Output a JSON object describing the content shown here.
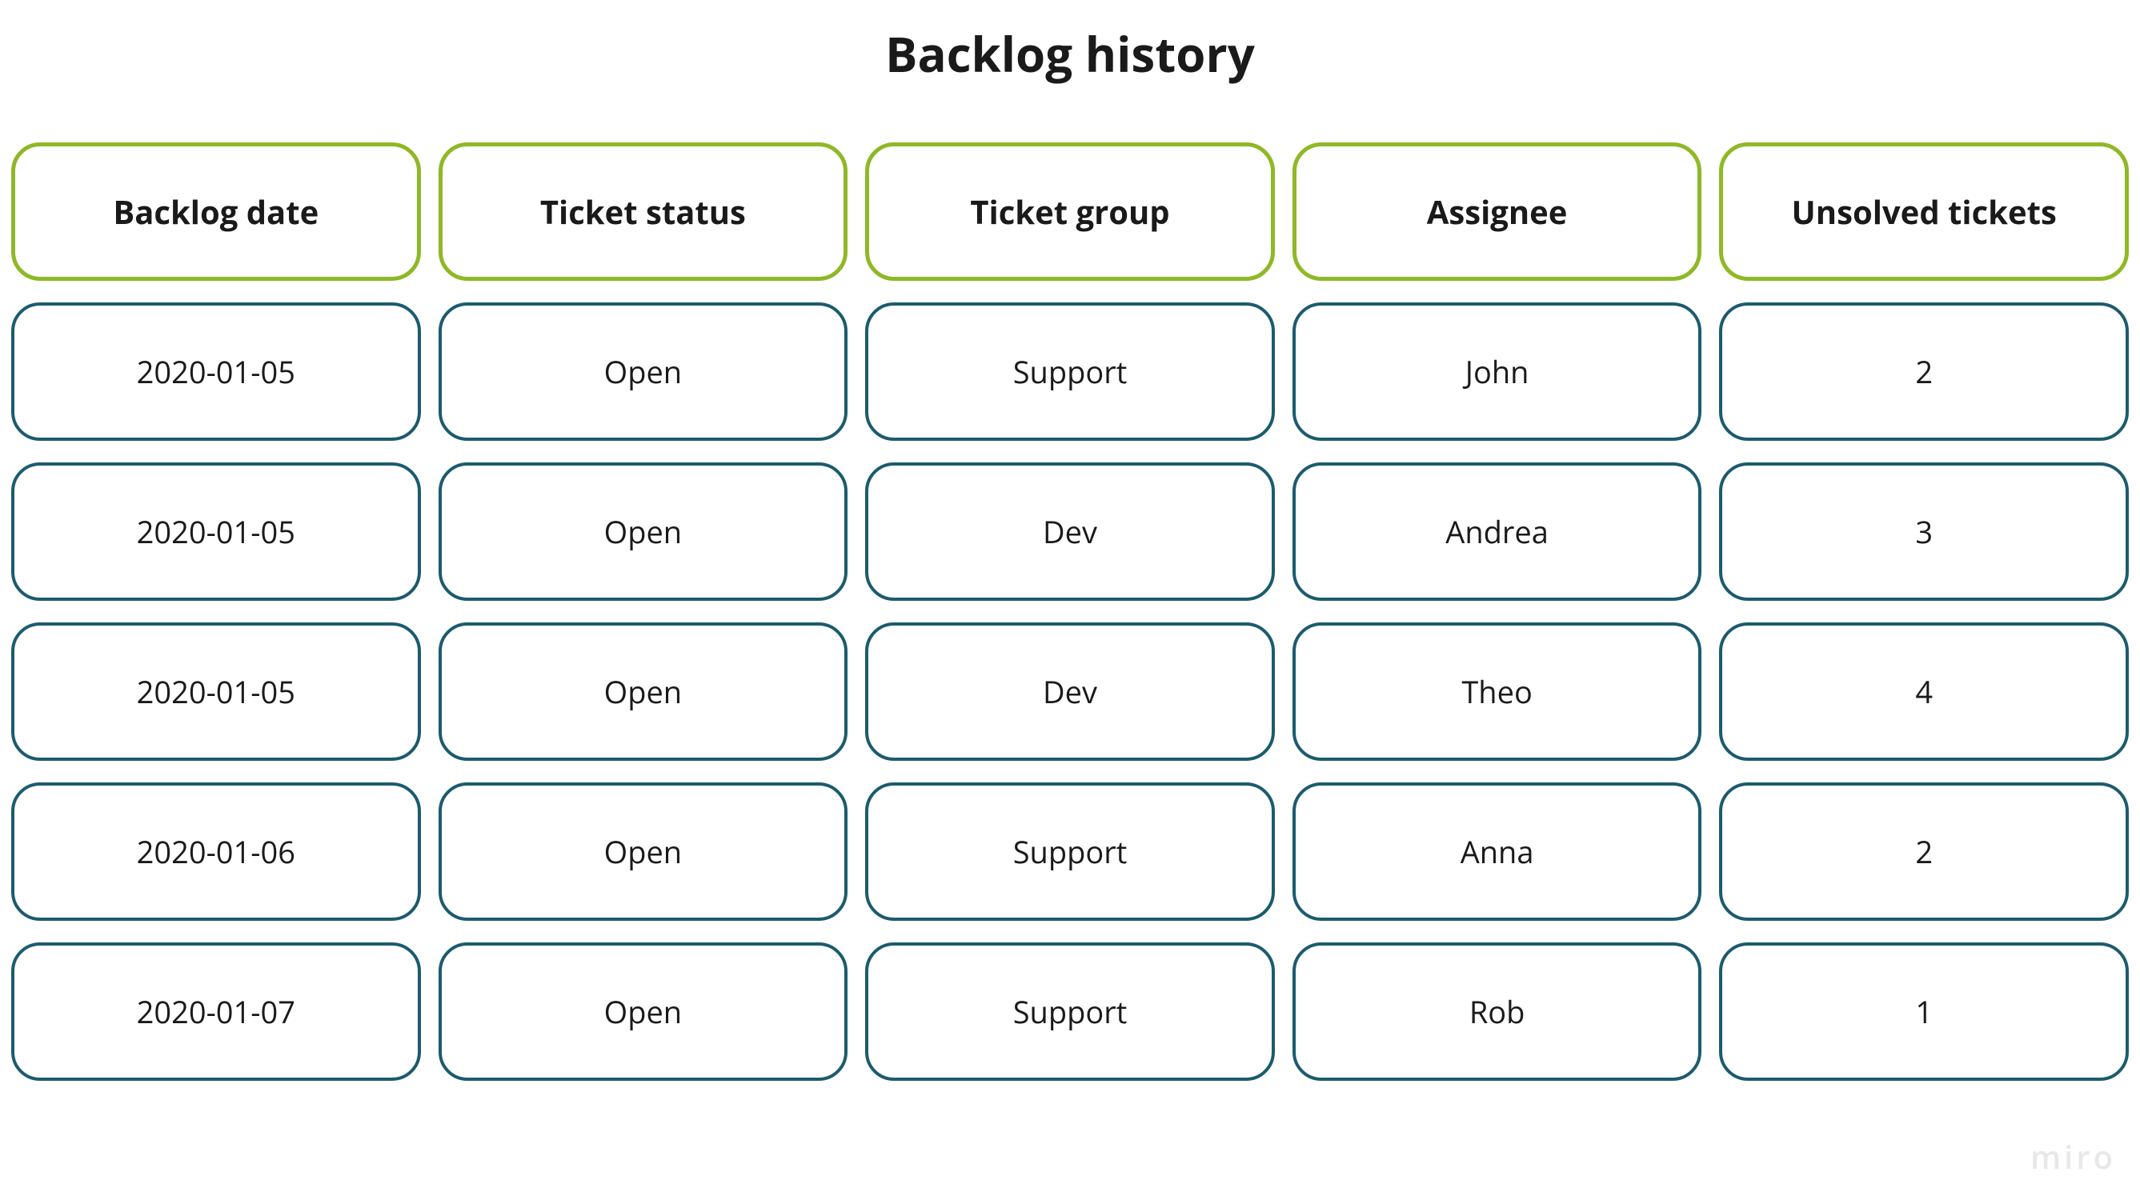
{
  "title": "Backlog history",
  "columns": [
    "Backlog date",
    "Ticket status",
    "Ticket group",
    "Assignee",
    "Unsolved tickets"
  ],
  "rows": [
    {
      "backlog_date": "2020-01-05",
      "ticket_status": "Open",
      "ticket_group": "Support",
      "assignee": "John",
      "unsolved_tickets": "2"
    },
    {
      "backlog_date": "2020-01-05",
      "ticket_status": "Open",
      "ticket_group": "Dev",
      "assignee": "Andrea",
      "unsolved_tickets": "3"
    },
    {
      "backlog_date": "2020-01-05",
      "ticket_status": "Open",
      "ticket_group": "Dev",
      "assignee": "Theo",
      "unsolved_tickets": "4"
    },
    {
      "backlog_date": "2020-01-06",
      "ticket_status": "Open",
      "ticket_group": "Support",
      "assignee": "Anna",
      "unsolved_tickets": "2"
    },
    {
      "backlog_date": "2020-01-07",
      "ticket_status": "Open",
      "ticket_group": "Support",
      "assignee": "Rob",
      "unsolved_tickets": "1"
    }
  ],
  "watermark": "miro",
  "chart_data": {
    "type": "table",
    "title": "Backlog history",
    "columns": [
      "Backlog date",
      "Ticket status",
      "Ticket group",
      "Assignee",
      "Unsolved tickets"
    ],
    "rows": [
      [
        "2020-01-05",
        "Open",
        "Support",
        "John",
        2
      ],
      [
        "2020-01-05",
        "Open",
        "Dev",
        "Andrea",
        3
      ],
      [
        "2020-01-05",
        "Open",
        "Dev",
        "Theo",
        4
      ],
      [
        "2020-01-06",
        "Open",
        "Support",
        "Anna",
        2
      ],
      [
        "2020-01-07",
        "Open",
        "Support",
        "Rob",
        1
      ]
    ]
  }
}
